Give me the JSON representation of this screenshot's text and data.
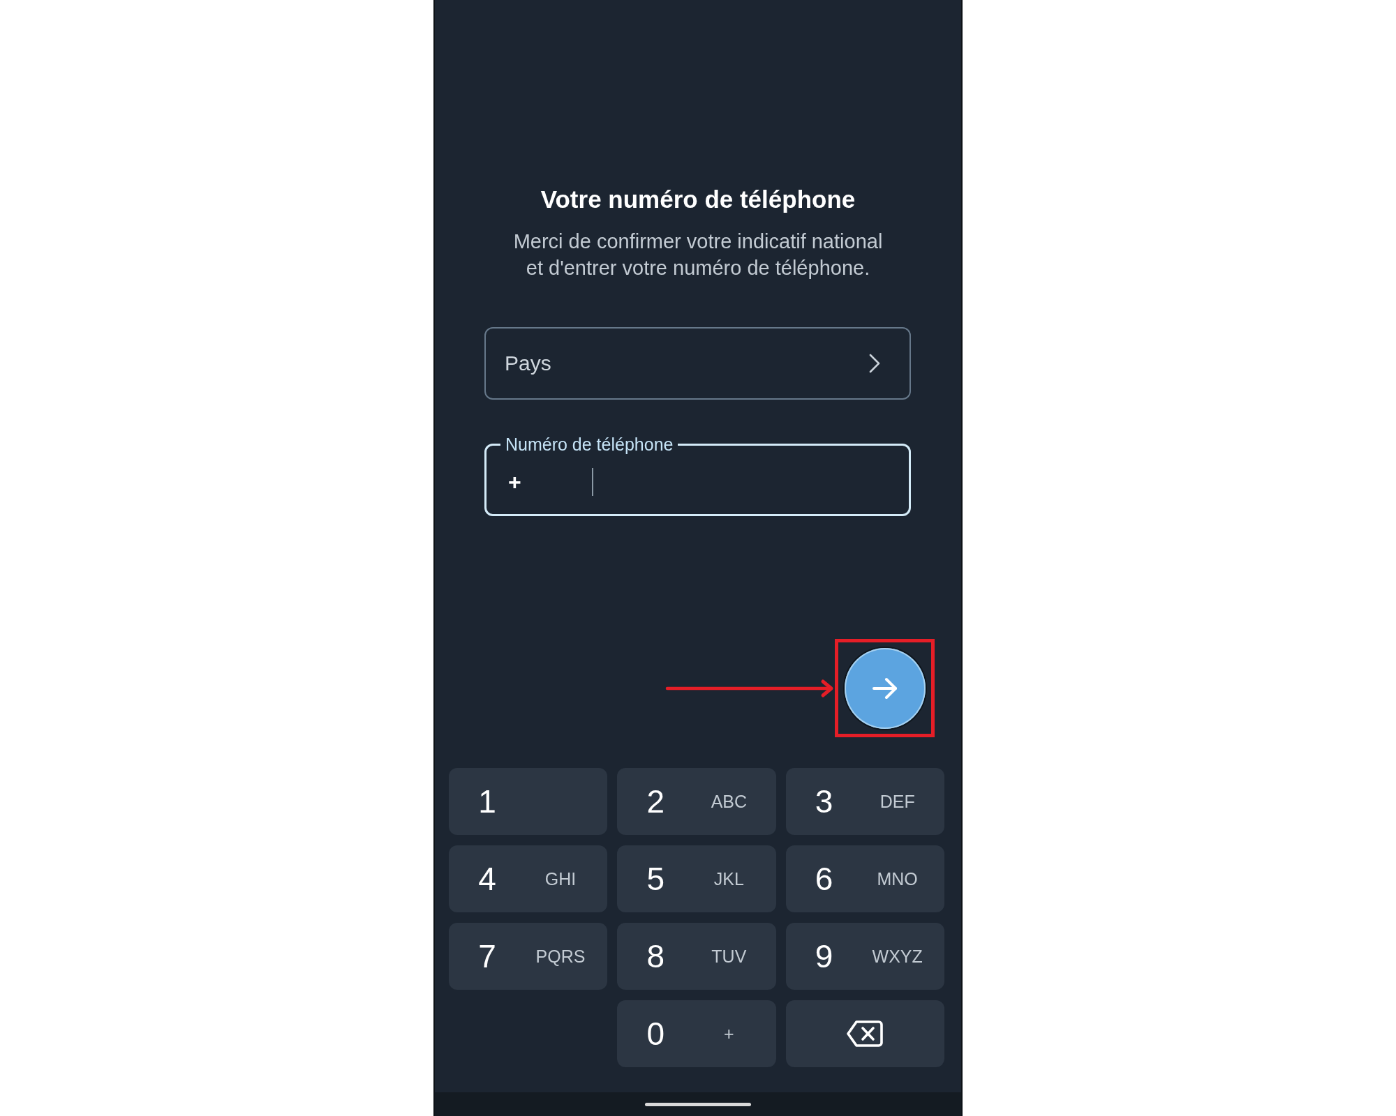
{
  "screen": {
    "title": "Votre numéro de téléphone",
    "subtitle": "Merci de confirmer votre indicatif national\net d'entrer votre numéro de téléphone."
  },
  "country_selector": {
    "label": "Pays"
  },
  "phone_field": {
    "label": "Numéro de téléphone",
    "prefix": "+",
    "focused": true
  },
  "keypad": [
    {
      "kind": "digit",
      "digit": "1"
    },
    {
      "kind": "digit",
      "digit": "2",
      "letters": "ABC"
    },
    {
      "kind": "digit",
      "digit": "3",
      "letters": "DEF"
    },
    {
      "kind": "digit",
      "digit": "4",
      "letters": "GHI"
    },
    {
      "kind": "digit",
      "digit": "5",
      "letters": "JKL"
    },
    {
      "kind": "digit",
      "digit": "6",
      "letters": "MNO"
    },
    {
      "kind": "digit",
      "digit": "7",
      "letters": "PQRS"
    },
    {
      "kind": "digit",
      "digit": "8",
      "letters": "TUV"
    },
    {
      "kind": "digit",
      "digit": "9",
      "letters": "WXYZ"
    },
    {
      "kind": "blank"
    },
    {
      "kind": "digit",
      "digit": "0",
      "letters": "+"
    },
    {
      "kind": "backspace"
    }
  ]
}
